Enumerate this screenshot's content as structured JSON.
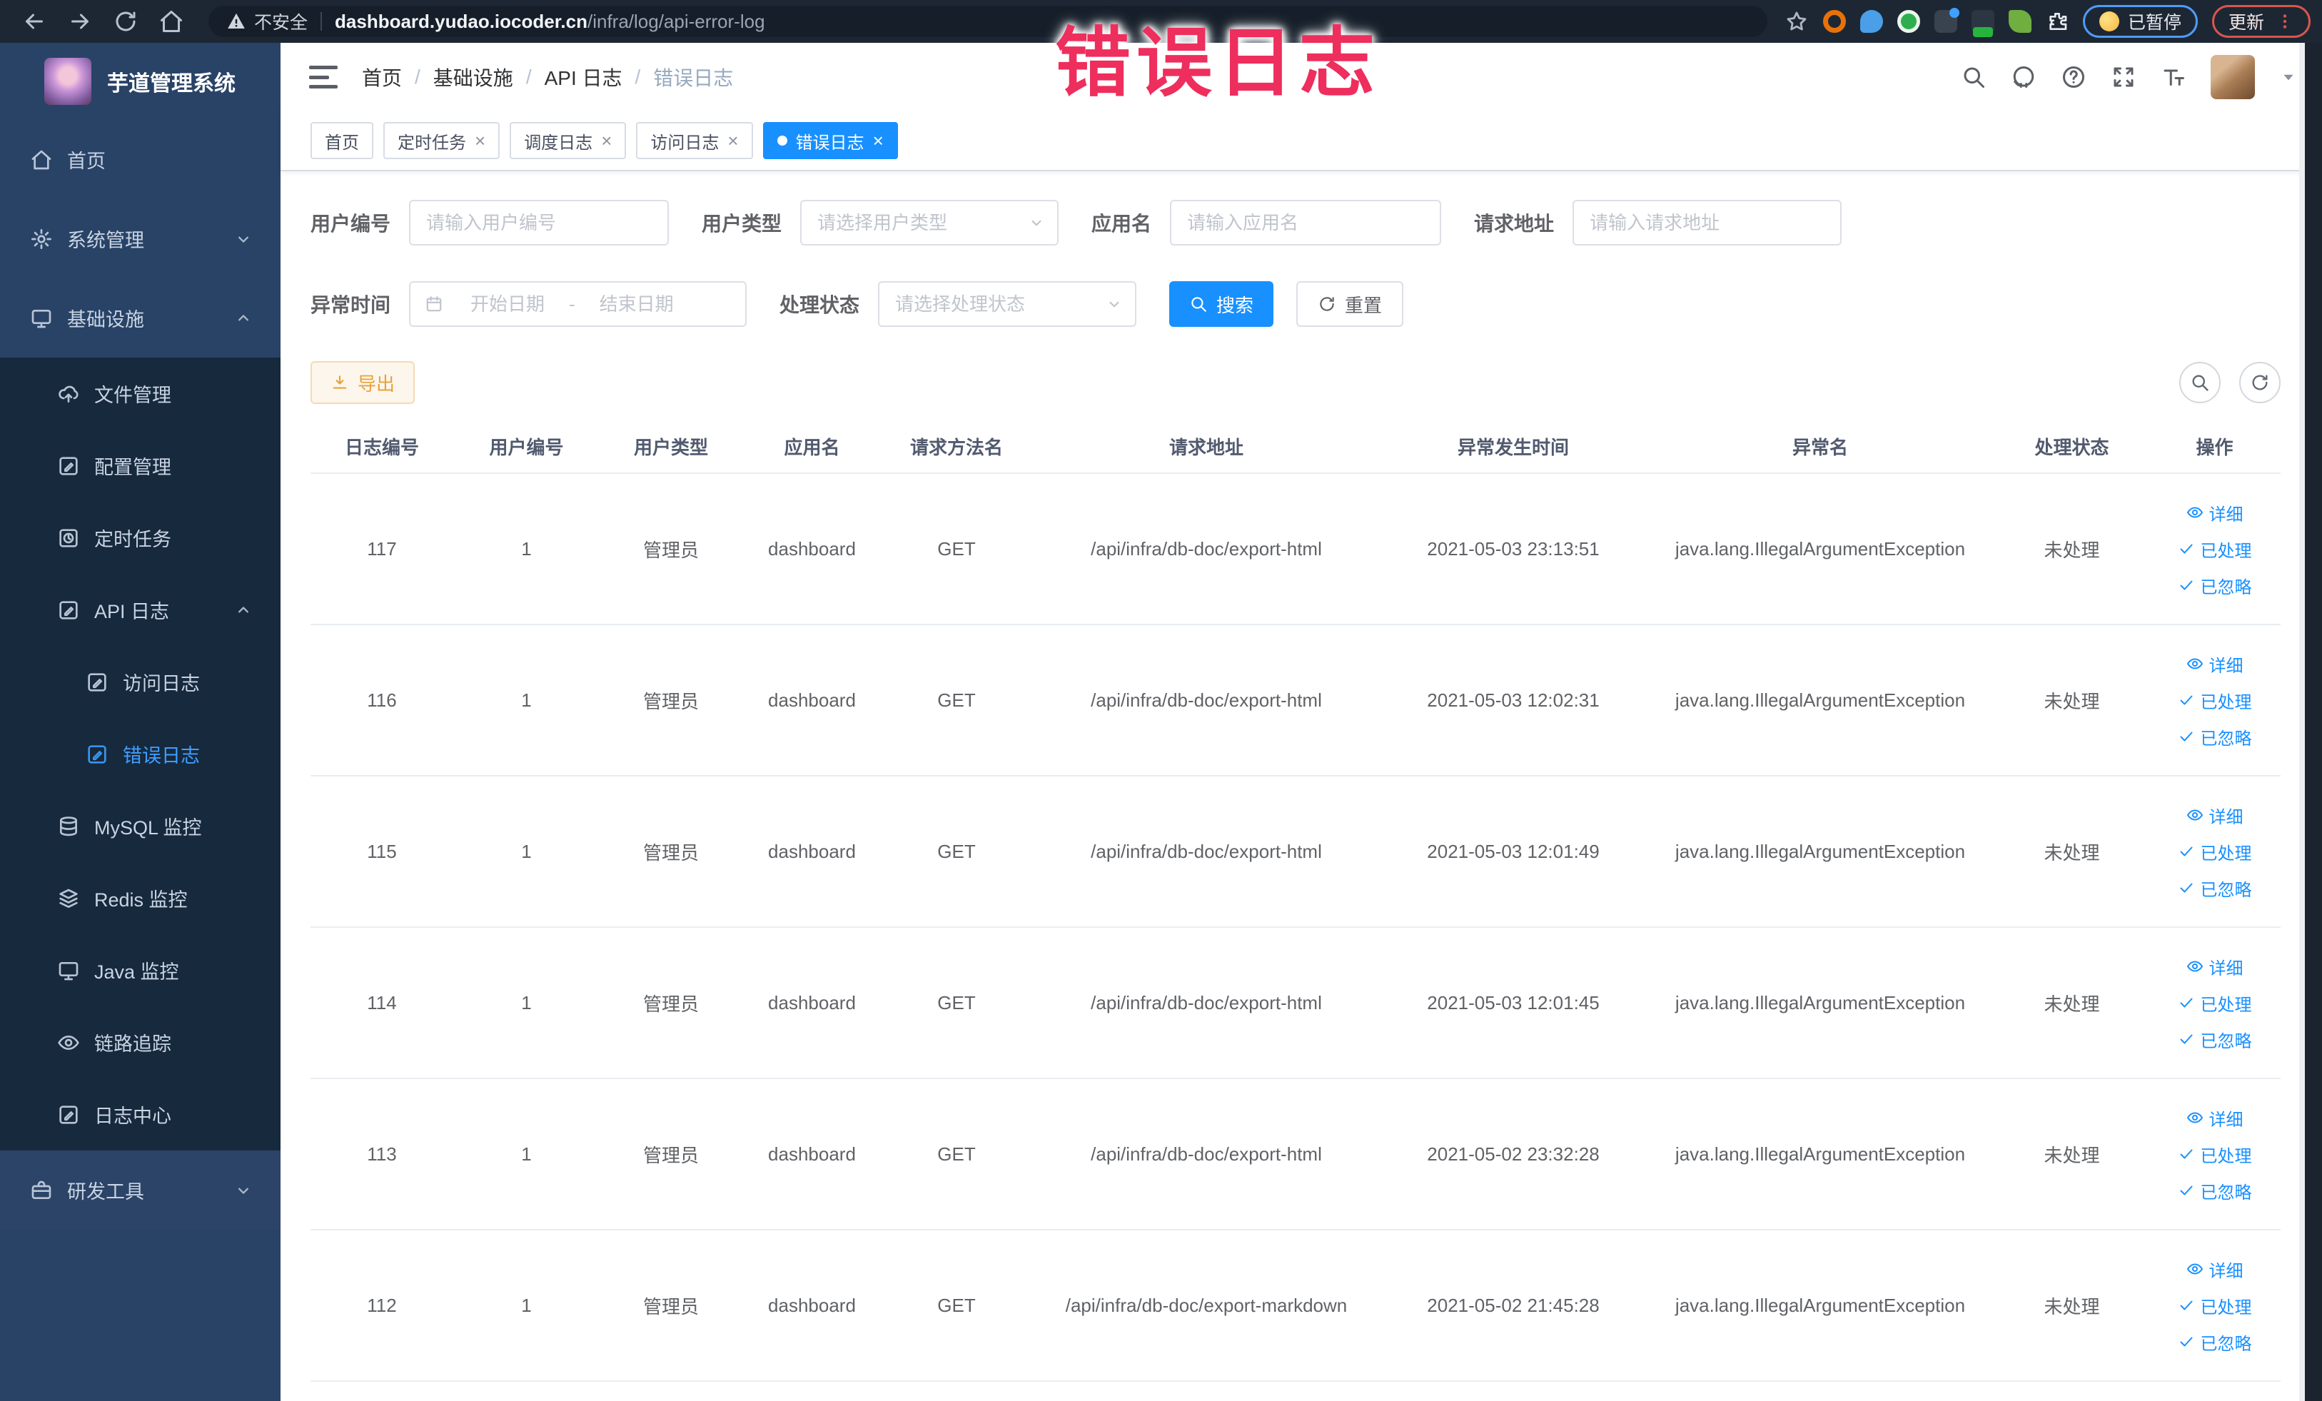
{
  "annotation": {
    "text": "错误日志",
    "color": "#ee2e5d"
  },
  "browser": {
    "security_label": "不安全",
    "url_domain": "dashboard.yudao.iocoder.cn",
    "url_path": "/infra/log/api-error-log",
    "paused_label": "已暂停",
    "update_label": "更新"
  },
  "sidebar": {
    "title": "芋道管理系统",
    "items": [
      {
        "label": "首页",
        "icon": "home",
        "level": 1,
        "section": "top"
      },
      {
        "label": "系统管理",
        "icon": "gear",
        "level": 1,
        "section": "top",
        "chevron": "down"
      },
      {
        "label": "基础设施",
        "icon": "monitor",
        "level": 1,
        "section": "top",
        "chevron": "up"
      },
      {
        "label": "文件管理",
        "icon": "cloud-upload",
        "level": 2,
        "section": "sub"
      },
      {
        "label": "配置管理",
        "icon": "edit-square",
        "level": 2,
        "section": "sub"
      },
      {
        "label": "定时任务",
        "icon": "timer",
        "level": 2,
        "section": "sub"
      },
      {
        "label": "API 日志",
        "icon": "log",
        "level": 2,
        "section": "sub",
        "chevron": "up"
      },
      {
        "label": "访问日志",
        "icon": "log",
        "level": 3,
        "section": "sub"
      },
      {
        "label": "错误日志",
        "icon": "log",
        "level": 3,
        "section": "sub",
        "active": true
      },
      {
        "label": "MySQL 监控",
        "icon": "database",
        "level": 2,
        "section": "sub"
      },
      {
        "label": "Redis 监控",
        "icon": "layers",
        "level": 2,
        "section": "sub"
      },
      {
        "label": "Java 监控",
        "icon": "monitor",
        "level": 2,
        "section": "sub"
      },
      {
        "label": "链路追踪",
        "icon": "eye",
        "level": 2,
        "section": "sub"
      },
      {
        "label": "日志中心",
        "icon": "log",
        "level": 2,
        "section": "sub"
      },
      {
        "label": "研发工具",
        "icon": "briefcase",
        "level": 1,
        "section": "bottom",
        "chevron": "down"
      }
    ]
  },
  "header": {
    "breadcrumb": [
      {
        "label": "首页"
      },
      {
        "label": "基础设施"
      },
      {
        "label": "API 日志"
      },
      {
        "label": "错误日志",
        "current": true
      }
    ]
  },
  "tabs": [
    {
      "label": "首页"
    },
    {
      "label": "定时任务",
      "closable": true
    },
    {
      "label": "调度日志",
      "closable": true
    },
    {
      "label": "访问日志",
      "closable": true
    },
    {
      "label": "错误日志",
      "closable": true,
      "active": true
    }
  ],
  "filters": {
    "user_id": {
      "label": "用户编号",
      "placeholder": "请输入用户编号"
    },
    "user_type": {
      "label": "用户类型",
      "placeholder": "请选择用户类型"
    },
    "app_name": {
      "label": "应用名",
      "placeholder": "请输入应用名"
    },
    "request_url": {
      "label": "请求地址",
      "placeholder": "请输入请求地址"
    },
    "exception_time": {
      "label": "异常时间",
      "start_placeholder": "开始日期",
      "separator": "-",
      "end_placeholder": "结束日期"
    },
    "process_status": {
      "label": "处理状态",
      "placeholder": "请选择处理状态"
    },
    "search_label": "搜索",
    "reset_label": "重置"
  },
  "toolbar": {
    "export_label": "导出"
  },
  "table": {
    "columns": [
      "日志编号",
      "用户编号",
      "用户类型",
      "应用名",
      "请求方法名",
      "请求地址",
      "异常发生时间",
      "异常名",
      "处理状态",
      "操作"
    ],
    "row_actions": [
      {
        "icon": "eye",
        "label": "详细"
      },
      {
        "icon": "check",
        "label": "已处理"
      },
      {
        "icon": "check",
        "label": "已忽略"
      }
    ],
    "rows": [
      {
        "id": "117",
        "user_id": "1",
        "user_type": "管理员",
        "app": "dashboard",
        "method": "GET",
        "url": "/api/infra/db-doc/export-html",
        "time": "2021-05-03 23:13:51",
        "exception": "java.lang.IllegalArgumentException",
        "status": "未处理"
      },
      {
        "id": "116",
        "user_id": "1",
        "user_type": "管理员",
        "app": "dashboard",
        "method": "GET",
        "url": "/api/infra/db-doc/export-html",
        "time": "2021-05-03 12:02:31",
        "exception": "java.lang.IllegalArgumentException",
        "status": "未处理"
      },
      {
        "id": "115",
        "user_id": "1",
        "user_type": "管理员",
        "app": "dashboard",
        "method": "GET",
        "url": "/api/infra/db-doc/export-html",
        "time": "2021-05-03 12:01:49",
        "exception": "java.lang.IllegalArgumentException",
        "status": "未处理"
      },
      {
        "id": "114",
        "user_id": "1",
        "user_type": "管理员",
        "app": "dashboard",
        "method": "GET",
        "url": "/api/infra/db-doc/export-html",
        "time": "2021-05-03 12:01:45",
        "exception": "java.lang.IllegalArgumentException",
        "status": "未处理"
      },
      {
        "id": "113",
        "user_id": "1",
        "user_type": "管理员",
        "app": "dashboard",
        "method": "GET",
        "url": "/api/infra/db-doc/export-html",
        "time": "2021-05-02 23:32:28",
        "exception": "java.lang.IllegalArgumentException",
        "status": "未处理"
      },
      {
        "id": "112",
        "user_id": "1",
        "user_type": "管理员",
        "app": "dashboard",
        "method": "GET",
        "url": "/api/infra/db-doc/export-markdown",
        "time": "2021-05-02 21:45:28",
        "exception": "java.lang.IllegalArgumentException",
        "status": "未处理"
      }
    ]
  },
  "colors": {
    "accent": "#1890ff",
    "sidebar_active": "#409eff",
    "warning": "#e6a23c",
    "annotation": "#ee2e5d"
  }
}
